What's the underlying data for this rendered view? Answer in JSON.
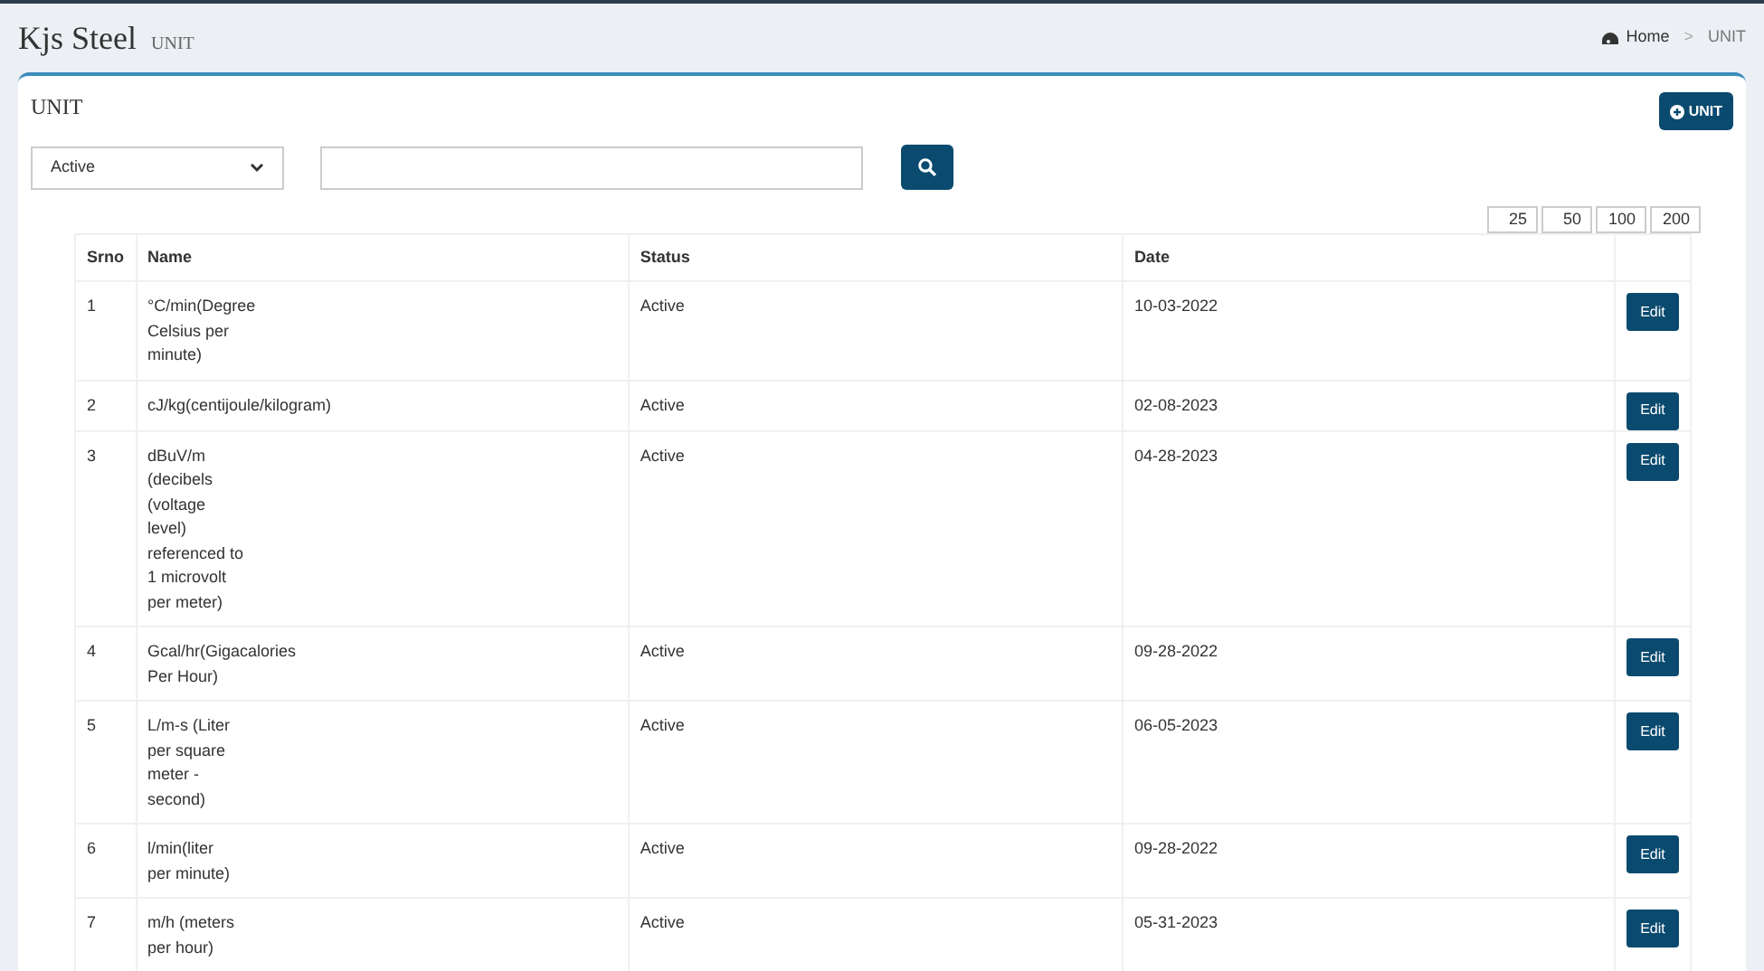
{
  "header": {
    "brand": "Kjs Steel",
    "subtitle": "UNIT",
    "breadcrumb": [
      "Home",
      "UNIT"
    ],
    "breadcrumb_separator": ">"
  },
  "card": {
    "title": "UNIT",
    "add_button": "UNIT"
  },
  "filter": {
    "status": "Active"
  },
  "page_sizes": [
    {
      "label": "25",
      "selected": false
    },
    {
      "label": "50",
      "selected": false
    },
    {
      "label": "100",
      "selected": false
    },
    {
      "label": "200",
      "selected": false
    }
  ],
  "table": {
    "columns": [
      "Srno",
      "Name",
      "Status",
      "Date"
    ],
    "rows": [
      {
        "srno": "1",
        "name": "°C/min(Degree\nCelsius per\nminute)",
        "status": "Active",
        "date": "10-03-2022",
        "action": "Edit"
      },
      {
        "srno": "2",
        "name": "cJ/kg(centijoule/kilogram)",
        "status": "Active",
        "date": "02-08-2023",
        "action": "Edit"
      },
      {
        "srno": "3",
        "name": "dBuV/m\n(decibels\n(voltage\nlevel)\nreferenced to\n1 microvolt\nper meter)",
        "status": "Active",
        "date": "04-28-2023",
        "action": "Edit"
      },
      {
        "srno": "4",
        "name": "Gcal/hr(Gigacalories\nPer Hour)",
        "status": "Active",
        "date": "09-28-2022",
        "action": "Edit"
      },
      {
        "srno": "5",
        "name": "L/m-s (Liter\nper square\nmeter -\nsecond)",
        "status": "Active",
        "date": "06-05-2023",
        "action": "Edit"
      },
      {
        "srno": "6",
        "name": "l/min(liter\nper minute)",
        "status": "Active",
        "date": "09-28-2022",
        "action": "Edit"
      },
      {
        "srno": "7",
        "name": "m/h (meters\nper hour)",
        "status": "Active",
        "date": "05-31-2023",
        "action": "Edit"
      }
    ]
  }
}
